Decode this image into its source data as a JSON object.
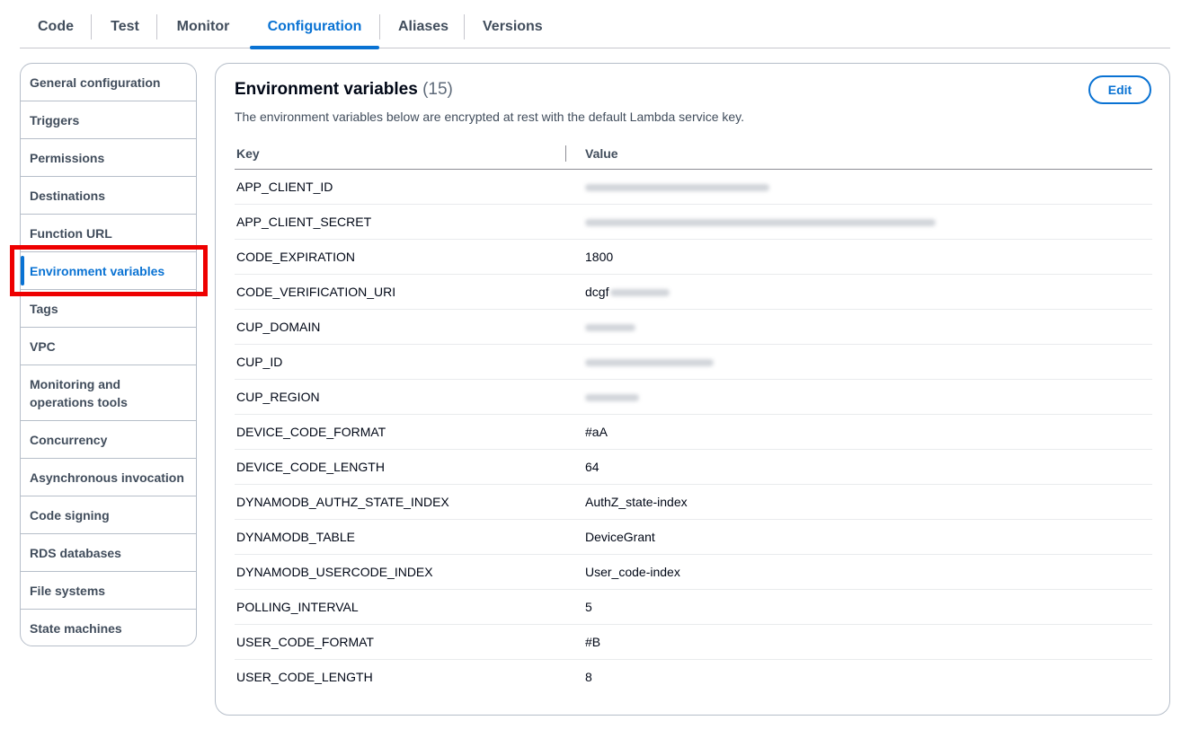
{
  "tabs": [
    {
      "label": "Code",
      "active": false
    },
    {
      "label": "Test",
      "active": false
    },
    {
      "label": "Monitor",
      "active": false
    },
    {
      "label": "Configuration",
      "active": true
    },
    {
      "label": "Aliases",
      "active": false
    },
    {
      "label": "Versions",
      "active": false
    }
  ],
  "sidenav": {
    "items": [
      {
        "label": "General configuration"
      },
      {
        "label": "Triggers"
      },
      {
        "label": "Permissions"
      },
      {
        "label": "Destinations"
      },
      {
        "label": "Function URL"
      },
      {
        "label": "Environment variables",
        "active": true
      },
      {
        "label": "Tags"
      },
      {
        "label": "VPC"
      },
      {
        "label": "Monitoring and operations tools"
      },
      {
        "label": "Concurrency"
      },
      {
        "label": "Asynchronous invocation"
      },
      {
        "label": "Code signing"
      },
      {
        "label": "RDS databases"
      },
      {
        "label": "File systems"
      },
      {
        "label": "State machines"
      }
    ]
  },
  "panel": {
    "title": "Environment variables",
    "count": "(15)",
    "description": "The environment variables below are encrypted at rest with the default Lambda service key.",
    "edit_label": "Edit"
  },
  "table": {
    "headers": {
      "key": "Key",
      "value": "Value"
    },
    "rows": [
      {
        "key": "APP_CLIENT_ID",
        "value": "",
        "redacted": true
      },
      {
        "key": "APP_CLIENT_SECRET",
        "value": "",
        "redacted": true
      },
      {
        "key": "CODE_EXPIRATION",
        "value": "1800"
      },
      {
        "key": "CODE_VERIFICATION_URI",
        "value": "dcgf",
        "partially_redacted": true
      },
      {
        "key": "CUP_DOMAIN",
        "value": "",
        "redacted": true
      },
      {
        "key": "CUP_ID",
        "value": "",
        "redacted": true
      },
      {
        "key": "CUP_REGION",
        "value": "",
        "redacted": true
      },
      {
        "key": "DEVICE_CODE_FORMAT",
        "value": "#aA"
      },
      {
        "key": "DEVICE_CODE_LENGTH",
        "value": "64"
      },
      {
        "key": "DYNAMODB_AUTHZ_STATE_INDEX",
        "value": "AuthZ_state-index"
      },
      {
        "key": "DYNAMODB_TABLE",
        "value": "DeviceGrant"
      },
      {
        "key": "DYNAMODB_USERCODE_INDEX",
        "value": "User_code-index"
      },
      {
        "key": "POLLING_INTERVAL",
        "value": "5"
      },
      {
        "key": "USER_CODE_FORMAT",
        "value": "#B"
      },
      {
        "key": "USER_CODE_LENGTH",
        "value": "8"
      }
    ]
  },
  "colors": {
    "accent": "#0972d3",
    "highlight_box": "#ee0000"
  }
}
